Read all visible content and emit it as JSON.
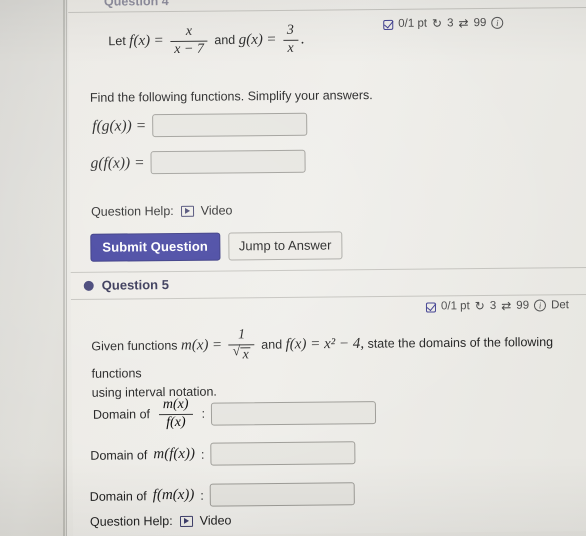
{
  "page": {
    "cut_off_title": "Question 4"
  },
  "question4": {
    "badge": {
      "points": "0/1 pt",
      "attempts_icon": "refresh-icon",
      "attempts": "3",
      "versions_icon": "shuffle-icon",
      "versions": "99",
      "info_icon": "info-icon"
    },
    "prompt_prefix": "Let",
    "f_label": "f(x)",
    "f_num": "x",
    "f_den": "x − 7",
    "conjunction": "and",
    "g_label": "g(x)",
    "g_num": "3",
    "g_den": "x",
    "prompt_suffix": ".",
    "instruction": "Find the following functions. Simplify your answers.",
    "answers": [
      {
        "label": "f(g(x)) =",
        "value": "",
        "placeholder": ""
      },
      {
        "label": "g(f(x)) =",
        "value": "",
        "placeholder": ""
      }
    ],
    "help_label": "Question Help:",
    "help_link": "Video",
    "submit_label": "Submit Question",
    "jump_label": "Jump to Answer"
  },
  "question5": {
    "title": "Question 5",
    "badge": {
      "points": "0/1 pt",
      "attempts_icon": "refresh-icon",
      "attempts": "3",
      "versions_icon": "shuffle-icon",
      "versions": "99",
      "info_icon": "info-icon",
      "details": "Det"
    },
    "prompt_prefix": "Given functions",
    "m_label": "m(x)",
    "m_num": "1",
    "m_den_radicand": "x",
    "conjunction": "and",
    "f_expr": "f(x) = x² − 4,",
    "prompt_mid": "state the domains of the following functions",
    "prompt_line2": "using interval notation.",
    "domains": [
      {
        "label": "Domain of",
        "expr_type": "fraction",
        "num": "m(x)",
        "den": "f(x)",
        "colon": ":",
        "value": ""
      },
      {
        "label": "Domain of",
        "expr_type": "inline",
        "expr": "m(f(x))",
        "colon": ":",
        "value": ""
      },
      {
        "label": "Domain of",
        "expr_type": "inline",
        "expr": "f(m(x))",
        "colon": ":",
        "value": ""
      }
    ],
    "help_label": "Question Help:",
    "help_link": "Video"
  },
  "colors": {
    "primary_button": "#3b3b9c",
    "accent": "#3b3b70",
    "page_background": "#eceae5",
    "input_background": "#e6e5e0"
  }
}
